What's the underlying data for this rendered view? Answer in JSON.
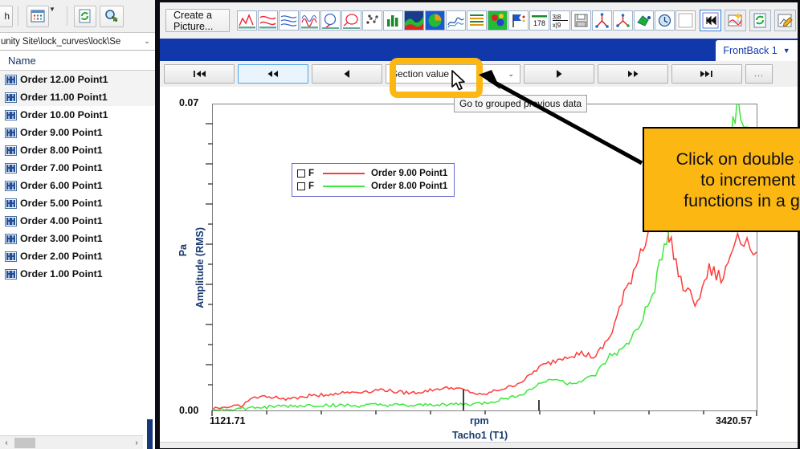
{
  "left_panel": {
    "toolbar": {
      "partial_button_label": "h",
      "grid_icon": "grid-view-icon",
      "dropdown_caret_icon": "chevron-down-icon",
      "refresh_icon": "refresh-icon",
      "search_icon": "search-run-icon"
    },
    "path": {
      "value": "unity Site\\lock_curves\\lock\\Se",
      "caret_icon": "chevron-down-icon"
    },
    "column_header": "Name",
    "items": [
      {
        "label": "Order 12.00 Point1",
        "icon": "waveform-icon"
      },
      {
        "label": "Order 11.00 Point1",
        "icon": "waveform-icon"
      },
      {
        "label": "Order 10.00 Point1",
        "icon": "waveform-icon"
      },
      {
        "label": "Order 9.00 Point1",
        "icon": "waveform-icon"
      },
      {
        "label": "Order 8.00 Point1",
        "icon": "waveform-icon"
      },
      {
        "label": "Order 7.00 Point1",
        "icon": "waveform-icon"
      },
      {
        "label": "Order 6.00 Point1",
        "icon": "waveform-icon"
      },
      {
        "label": "Order 5.00 Point1",
        "icon": "waveform-icon"
      },
      {
        "label": "Order 4.00 Point1",
        "icon": "waveform-icon"
      },
      {
        "label": "Order 3.00 Point1",
        "icon": "waveform-icon"
      },
      {
        "label": "Order 2.00 Point1",
        "icon": "waveform-icon"
      },
      {
        "label": "Order 1.00 Point1",
        "icon": "waveform-icon"
      }
    ],
    "scrollbar": {
      "left_arrow_icon": "chevron-left-icon",
      "right_arrow_icon": "chevron-right-icon"
    }
  },
  "toolbar": {
    "create_picture_label": "Create a Picture...",
    "icons": [
      "line-chart-icon",
      "overlay-curves-icon",
      "stacked-curves-icon",
      "wave-curves-icon",
      "polar-plot-icon",
      "nyquist-plot-icon",
      "scatter-points-icon",
      "bar-chart-icon",
      "colormap-icon",
      "pie-chart-icon",
      "multi-curve-icon",
      "list-lines-icon",
      "contour-map-icon",
      "flag-marker-icon",
      "numeric-display-icon",
      "fraction-display-icon",
      "save-layout-icon",
      "modal-shape-icon",
      "modal-shape-alt-icon",
      "geometry-icon",
      "clock-icon",
      "blank-icon"
    ],
    "right_icons": [
      "step-forward-active-icon",
      "new-picture-icon",
      "refresh-picture-icon",
      "edit-picture-icon"
    ]
  },
  "tab_bar": {
    "active_tab": "FrontBack 1",
    "caret_icon": "chevron-down-icon"
  },
  "nav_bar": {
    "first_label": "|◀◀",
    "prev_group_label": "◀◀",
    "prev_label": "◀",
    "section_value": "Section value",
    "section_caret_icon": "chevron-down-icon",
    "next_label": "▶",
    "next_group_label": "▶▶",
    "last_label": "▶▶|",
    "more_label": "..."
  },
  "tooltip": {
    "text": "Go to grouped previous data"
  },
  "callout": {
    "line1": "Click on double arrow",
    "line2": "to increment all",
    "line3": "functions in a group",
    "color": "#FCB713"
  },
  "chart_data": {
    "type": "line",
    "title": "",
    "xlabel": "rpm",
    "xlabel_sub": "Tacho1 (T1)",
    "ylabel": "Amplitude (RMS)",
    "ylabel_unit": "Pa",
    "xlim": [
      1121.71,
      3420.57
    ],
    "ylim": [
      0.0,
      0.07
    ],
    "xtick_labels": [
      "1121.71",
      "3420.57"
    ],
    "ytick_labels": [
      "0.00",
      "0.07"
    ],
    "grid": false,
    "legend_position": "inside-left",
    "series": [
      {
        "name": "Order 9.00 Point1",
        "color": "#FF3B3B",
        "legend_prefix": "F",
        "x": [
          1121.71,
          1180,
          1240,
          1300,
          1360,
          1420,
          1480,
          1540,
          1600,
          1660,
          1720,
          1780,
          1840,
          1900,
          1960,
          2020,
          2080,
          2140,
          2200,
          2260,
          2320,
          2380,
          2440,
          2500,
          2560,
          2620,
          2680,
          2740,
          2800,
          2860,
          2920,
          2980,
          3040,
          3100,
          3160,
          3220,
          3280,
          3340,
          3420.57
        ],
        "y": [
          0.0005,
          0.0008,
          0.0012,
          0.003,
          0.0032,
          0.0026,
          0.003,
          0.0034,
          0.0036,
          0.004,
          0.0042,
          0.0044,
          0.0048,
          0.0042,
          0.004,
          0.0044,
          0.005,
          0.0052,
          0.0044,
          0.0034,
          0.0046,
          0.0054,
          0.007,
          0.0098,
          0.0112,
          0.0126,
          0.013,
          0.0122,
          0.0168,
          0.026,
          0.035,
          0.0438,
          0.043,
          0.029,
          0.0248,
          0.032,
          0.03,
          0.041,
          0.0362
        ]
      },
      {
        "name": "Order 8.00 Point1",
        "color": "#3EE83E",
        "legend_prefix": "F",
        "x": [
          1121.71,
          1180,
          1240,
          1300,
          1360,
          1420,
          1480,
          1540,
          1600,
          1660,
          1720,
          1780,
          1840,
          1900,
          1960,
          2020,
          2080,
          2140,
          2200,
          2260,
          2320,
          2380,
          2440,
          2500,
          2560,
          2620,
          2680,
          2740,
          2800,
          2860,
          2920,
          2980,
          3040,
          3100,
          3160,
          3220,
          3280,
          3340,
          3420.57
        ],
        "y": [
          0.0002,
          0.0003,
          0.0004,
          0.0006,
          0.0008,
          0.001,
          0.001,
          0.0012,
          0.0012,
          0.0012,
          0.001,
          0.0012,
          0.0012,
          0.0012,
          0.001,
          0.0012,
          0.0014,
          0.0014,
          0.0014,
          0.0016,
          0.0022,
          0.003,
          0.004,
          0.006,
          0.0074,
          0.0062,
          0.0066,
          0.0082,
          0.0124,
          0.014,
          0.019,
          0.026,
          0.0392,
          0.044,
          0.052,
          0.058,
          0.054,
          0.069,
          0.063
        ]
      }
    ]
  }
}
